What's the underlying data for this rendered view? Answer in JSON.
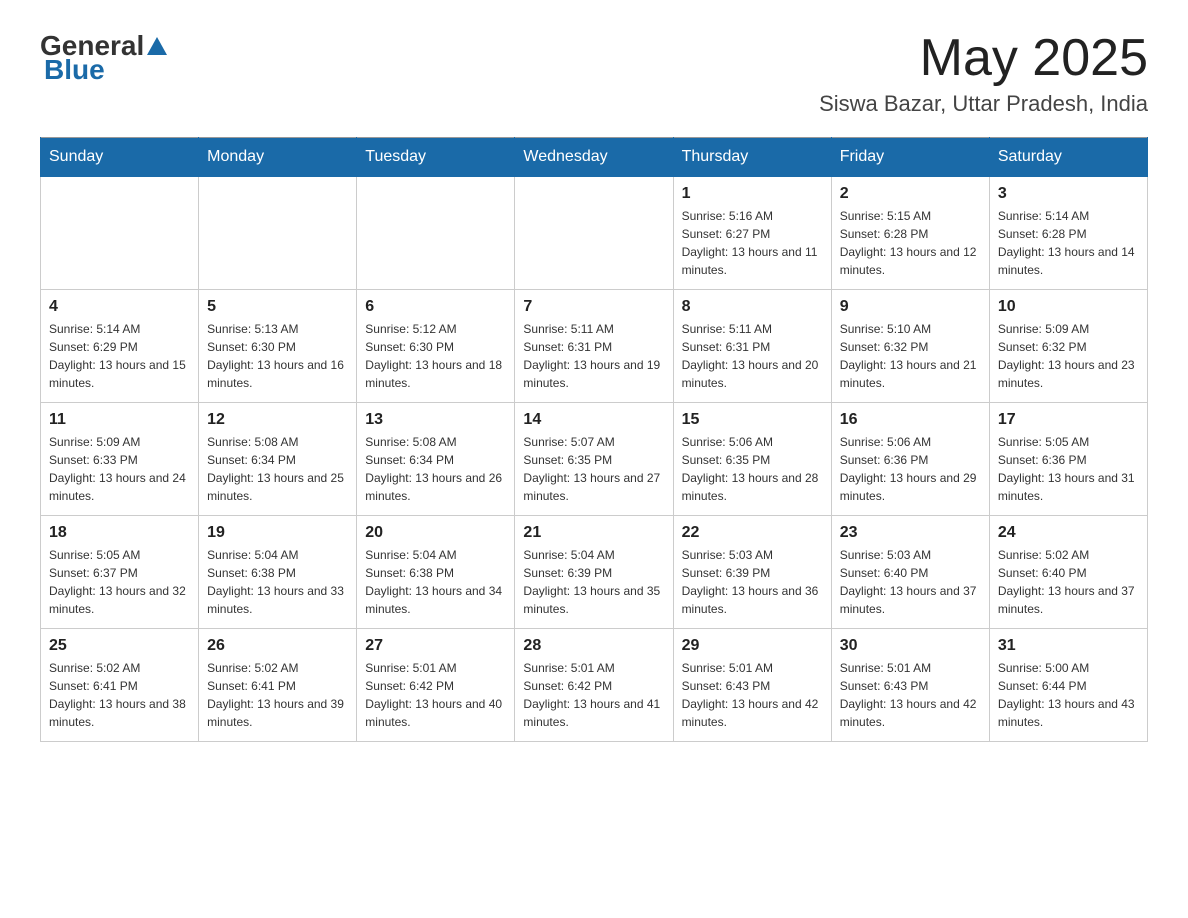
{
  "header": {
    "logo_general": "General",
    "logo_blue": "Blue",
    "month_year": "May 2025",
    "location": "Siswa Bazar, Uttar Pradesh, India"
  },
  "days_of_week": [
    "Sunday",
    "Monday",
    "Tuesday",
    "Wednesday",
    "Thursday",
    "Friday",
    "Saturday"
  ],
  "weeks": [
    [
      {
        "day": "",
        "info": ""
      },
      {
        "day": "",
        "info": ""
      },
      {
        "day": "",
        "info": ""
      },
      {
        "day": "",
        "info": ""
      },
      {
        "day": "1",
        "info": "Sunrise: 5:16 AM\nSunset: 6:27 PM\nDaylight: 13 hours and 11 minutes."
      },
      {
        "day": "2",
        "info": "Sunrise: 5:15 AM\nSunset: 6:28 PM\nDaylight: 13 hours and 12 minutes."
      },
      {
        "day": "3",
        "info": "Sunrise: 5:14 AM\nSunset: 6:28 PM\nDaylight: 13 hours and 14 minutes."
      }
    ],
    [
      {
        "day": "4",
        "info": "Sunrise: 5:14 AM\nSunset: 6:29 PM\nDaylight: 13 hours and 15 minutes."
      },
      {
        "day": "5",
        "info": "Sunrise: 5:13 AM\nSunset: 6:30 PM\nDaylight: 13 hours and 16 minutes."
      },
      {
        "day": "6",
        "info": "Sunrise: 5:12 AM\nSunset: 6:30 PM\nDaylight: 13 hours and 18 minutes."
      },
      {
        "day": "7",
        "info": "Sunrise: 5:11 AM\nSunset: 6:31 PM\nDaylight: 13 hours and 19 minutes."
      },
      {
        "day": "8",
        "info": "Sunrise: 5:11 AM\nSunset: 6:31 PM\nDaylight: 13 hours and 20 minutes."
      },
      {
        "day": "9",
        "info": "Sunrise: 5:10 AM\nSunset: 6:32 PM\nDaylight: 13 hours and 21 minutes."
      },
      {
        "day": "10",
        "info": "Sunrise: 5:09 AM\nSunset: 6:32 PM\nDaylight: 13 hours and 23 minutes."
      }
    ],
    [
      {
        "day": "11",
        "info": "Sunrise: 5:09 AM\nSunset: 6:33 PM\nDaylight: 13 hours and 24 minutes."
      },
      {
        "day": "12",
        "info": "Sunrise: 5:08 AM\nSunset: 6:34 PM\nDaylight: 13 hours and 25 minutes."
      },
      {
        "day": "13",
        "info": "Sunrise: 5:08 AM\nSunset: 6:34 PM\nDaylight: 13 hours and 26 minutes."
      },
      {
        "day": "14",
        "info": "Sunrise: 5:07 AM\nSunset: 6:35 PM\nDaylight: 13 hours and 27 minutes."
      },
      {
        "day": "15",
        "info": "Sunrise: 5:06 AM\nSunset: 6:35 PM\nDaylight: 13 hours and 28 minutes."
      },
      {
        "day": "16",
        "info": "Sunrise: 5:06 AM\nSunset: 6:36 PM\nDaylight: 13 hours and 29 minutes."
      },
      {
        "day": "17",
        "info": "Sunrise: 5:05 AM\nSunset: 6:36 PM\nDaylight: 13 hours and 31 minutes."
      }
    ],
    [
      {
        "day": "18",
        "info": "Sunrise: 5:05 AM\nSunset: 6:37 PM\nDaylight: 13 hours and 32 minutes."
      },
      {
        "day": "19",
        "info": "Sunrise: 5:04 AM\nSunset: 6:38 PM\nDaylight: 13 hours and 33 minutes."
      },
      {
        "day": "20",
        "info": "Sunrise: 5:04 AM\nSunset: 6:38 PM\nDaylight: 13 hours and 34 minutes."
      },
      {
        "day": "21",
        "info": "Sunrise: 5:04 AM\nSunset: 6:39 PM\nDaylight: 13 hours and 35 minutes."
      },
      {
        "day": "22",
        "info": "Sunrise: 5:03 AM\nSunset: 6:39 PM\nDaylight: 13 hours and 36 minutes."
      },
      {
        "day": "23",
        "info": "Sunrise: 5:03 AM\nSunset: 6:40 PM\nDaylight: 13 hours and 37 minutes."
      },
      {
        "day": "24",
        "info": "Sunrise: 5:02 AM\nSunset: 6:40 PM\nDaylight: 13 hours and 37 minutes."
      }
    ],
    [
      {
        "day": "25",
        "info": "Sunrise: 5:02 AM\nSunset: 6:41 PM\nDaylight: 13 hours and 38 minutes."
      },
      {
        "day": "26",
        "info": "Sunrise: 5:02 AM\nSunset: 6:41 PM\nDaylight: 13 hours and 39 minutes."
      },
      {
        "day": "27",
        "info": "Sunrise: 5:01 AM\nSunset: 6:42 PM\nDaylight: 13 hours and 40 minutes."
      },
      {
        "day": "28",
        "info": "Sunrise: 5:01 AM\nSunset: 6:42 PM\nDaylight: 13 hours and 41 minutes."
      },
      {
        "day": "29",
        "info": "Sunrise: 5:01 AM\nSunset: 6:43 PM\nDaylight: 13 hours and 42 minutes."
      },
      {
        "day": "30",
        "info": "Sunrise: 5:01 AM\nSunset: 6:43 PM\nDaylight: 13 hours and 42 minutes."
      },
      {
        "day": "31",
        "info": "Sunrise: 5:00 AM\nSunset: 6:44 PM\nDaylight: 13 hours and 43 minutes."
      }
    ]
  ]
}
